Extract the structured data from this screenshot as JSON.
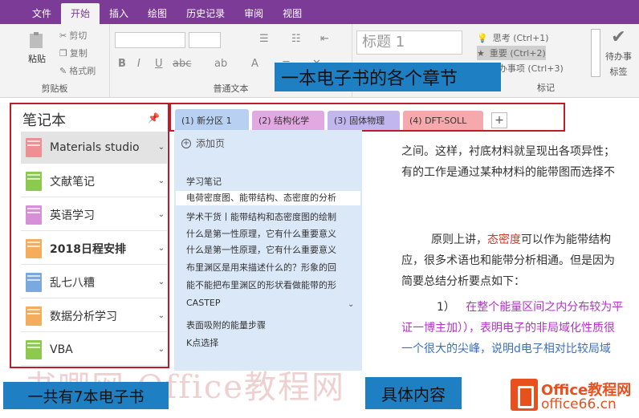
{
  "menu": [
    "文件",
    "开始",
    "插入",
    "绘图",
    "历史记录",
    "审阅",
    "视图"
  ],
  "active_menu": "开始",
  "ribbon": {
    "clipboard": {
      "paste": "粘贴",
      "cut": "剪切",
      "copy": "复制",
      "format": "格式刷",
      "label": "剪贴板"
    },
    "basic_text": {
      "label": "普通文本"
    },
    "style": "标题 1",
    "tags": {
      "t1": "思考 (Ctrl+1)",
      "t2": "重要 (Ctrl+2)",
      "t3": "待办事项 (Ctrl+3)",
      "label": "标记",
      "todo": "待办事",
      "todo2": "标签"
    }
  },
  "annotations": {
    "chapters": "一本电子书的各个章节",
    "books": "一共有7本电子书",
    "content": "具体内容"
  },
  "notebook_panel": {
    "title": "笔记本",
    "items": [
      {
        "name": "Materials studio",
        "color": "#f08f93",
        "bold": false
      },
      {
        "name": "文献笔记",
        "color": "#8cc94e",
        "bold": false
      },
      {
        "name": "英语学习",
        "color": "#d690d8",
        "bold": false
      },
      {
        "name": "2018日程安排",
        "color": "#f5ad5b",
        "bold": true
      },
      {
        "name": "乱七八糟",
        "color": "#79a9de",
        "bold": false
      },
      {
        "name": "数据分析学习",
        "color": "#f5ad5b",
        "bold": false
      },
      {
        "name": "VBA",
        "color": "#8cc94e",
        "bold": false
      }
    ]
  },
  "sections": [
    {
      "label": "(1) 新分区 1",
      "color": "#b8d1f2"
    },
    {
      "label": "(2) 结构化学",
      "color": "#e2a8e1"
    },
    {
      "label": "(3) 固体物理",
      "color": "#c2b6ef"
    },
    {
      "label": "(4) DFT-SOLL",
      "color": "#f6a9ad"
    }
  ],
  "pages": {
    "add_page": "添加页",
    "items": [
      "学习笔记",
      "电荷密度图、能带结构、态密度的分析",
      "学术干货丨能带结构和态密度图的绘制",
      "什么是第一性原理，它有什么重要意义",
      "什么是第一性原理，它有什么重要意义",
      "布里渊区是用来描述什么的？形象的回",
      "能不能把布里渊区的形状看做能带的形",
      "CASTEP",
      "表面吸附的能量步骤",
      "K点选择"
    ]
  },
  "content": {
    "l1": "之间。这样，衬底材料就呈现出各项异性；",
    "l2": "有的工作是通过某种材料的能带图而选择不",
    "l3a": "原则上讲，",
    "l3b": "态密度",
    "l3c": "可以作为能带结构",
    "l4": "应，很多术语也和能带分析相通。但是因为",
    "l5": "简要总结分析要点如下：",
    "l6a": "1）",
    "l6b": "在整个能量区间之内分布较为平",
    "l7a": "证一博主加）），表明电子的",
    "l7b": "非局域化性质很",
    "l8": "一个很大的尖峰，说明d电子相对比较局域"
  },
  "watermark": "书唧网 Office教程网",
  "logo": {
    "line1": "Office教程网",
    "line2": "office66.cn"
  }
}
